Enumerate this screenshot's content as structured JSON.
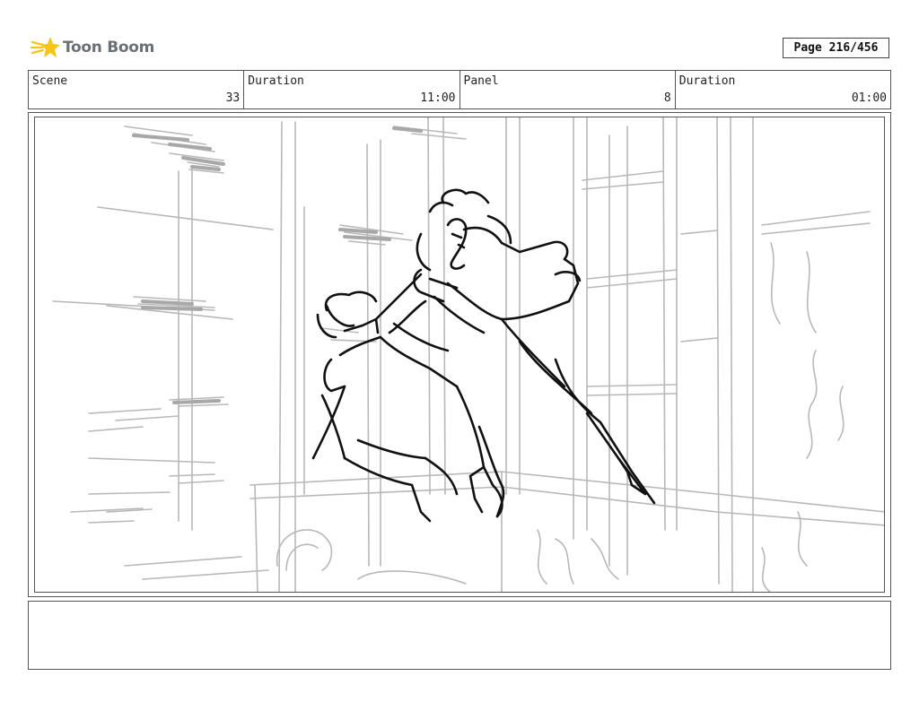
{
  "brand": {
    "name": "Toon Boom",
    "icon": "toon-boom-star-icon",
    "accent": "#f5c518"
  },
  "page": {
    "label": "Page 216/456"
  },
  "info": {
    "scene_label": "Scene",
    "scene_value": "33",
    "duration_label": "Duration",
    "duration_value": "11:00",
    "panel_label": "Panel",
    "panel_value": "8",
    "panel_duration_label": "Duration",
    "panel_duration_value": "01:00"
  },
  "panel": {
    "image": "storyboard-sketch"
  },
  "colors": {
    "sketch_dark": "#111111",
    "sketch_light": "#b5b5b5",
    "border": "#555555"
  }
}
